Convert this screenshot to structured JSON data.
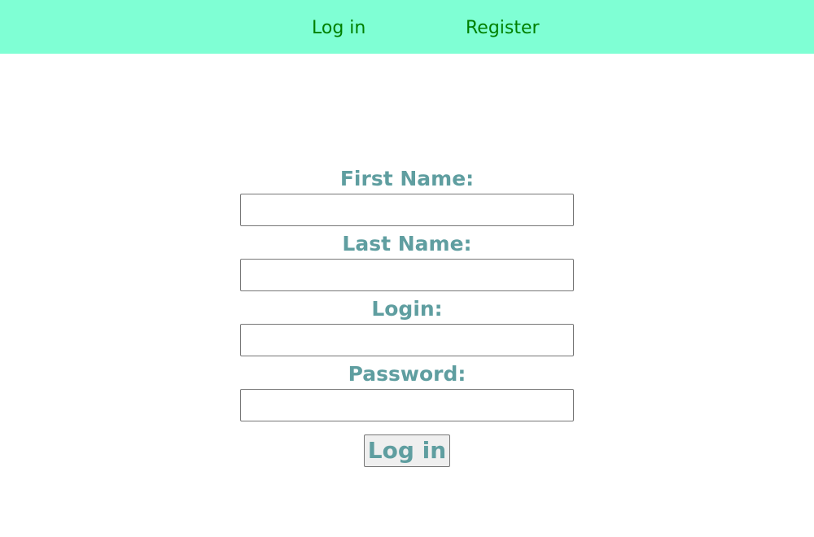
{
  "nav": {
    "login_label": "Log in",
    "register_label": "Register"
  },
  "form": {
    "fields": [
      {
        "label": "First Name:",
        "value": ""
      },
      {
        "label": "Last Name:",
        "value": ""
      },
      {
        "label": "Login:",
        "value": ""
      },
      {
        "label": "Password:",
        "value": ""
      }
    ],
    "submit_label": "Log in"
  },
  "colors": {
    "topbar_background": "#7fffd4",
    "nav_link": "#008000",
    "label_text": "#5f9ea0",
    "button_background": "#efefef"
  }
}
